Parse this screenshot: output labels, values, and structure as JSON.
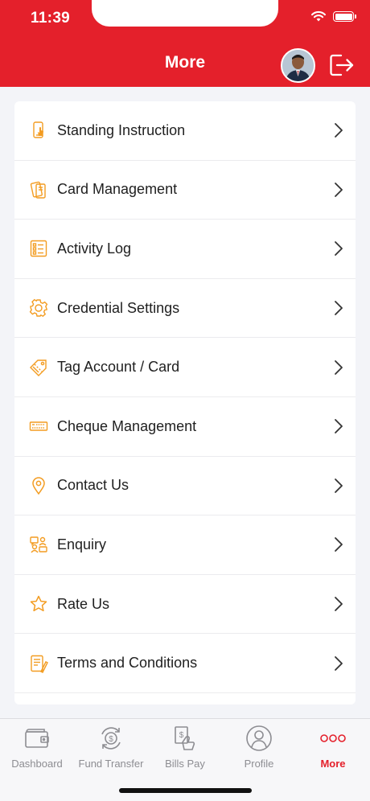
{
  "status_bar": {
    "time": "11:39"
  },
  "header": {
    "title": "More"
  },
  "menu": {
    "items": [
      {
        "label": "Standing Instruction",
        "icon": "phone-touch-icon"
      },
      {
        "label": "Card Management",
        "icon": "cards-icon"
      },
      {
        "label": "Activity Log",
        "icon": "checklist-icon"
      },
      {
        "label": "Credential Settings",
        "icon": "gear-icon"
      },
      {
        "label": "Tag Account / Card",
        "icon": "tag-icon"
      },
      {
        "label": "Cheque Management",
        "icon": "cheque-icon"
      },
      {
        "label": "Contact Us",
        "icon": "location-pin-icon"
      },
      {
        "label": "Enquiry",
        "icon": "enquiry-icon"
      },
      {
        "label": "Rate Us",
        "icon": "star-icon"
      },
      {
        "label": "Terms and Conditions",
        "icon": "document-icon"
      }
    ]
  },
  "tabbar": {
    "tabs": [
      {
        "label": "Dashboard",
        "icon": "wallet-icon"
      },
      {
        "label": "Fund Transfer",
        "icon": "money-transfer-icon"
      },
      {
        "label": "Bills Pay",
        "icon": "bill-icon"
      },
      {
        "label": "Profile",
        "icon": "user-icon"
      },
      {
        "label": "More",
        "icon": "more-dots-icon"
      }
    ],
    "active": "More"
  },
  "colors": {
    "brand": "#e4202b",
    "icon_accent": "#f39c21"
  }
}
